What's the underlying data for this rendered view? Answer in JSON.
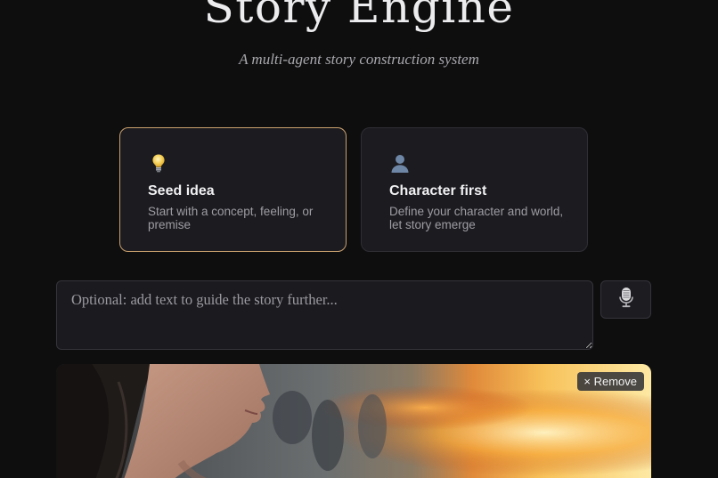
{
  "header": {
    "title": "Story Engine",
    "subtitle": "A multi-agent story construction system"
  },
  "modes": [
    {
      "icon": "lightbulb-icon",
      "title": "Seed idea",
      "description": "Start with a concept, feeling, or premise",
      "selected": true
    },
    {
      "icon": "person-silhouette-icon",
      "title": "Character first",
      "description": "Define your character and world, let story emerge",
      "selected": false
    }
  ],
  "guide_input": {
    "placeholder": "Optional: add text to guide the story further...",
    "value": ""
  },
  "mic_button": {
    "icon": "microphone-icon"
  },
  "image_upload": {
    "remove_label": "× Remove",
    "image_description": "uploaded reference image"
  },
  "colors": {
    "background": "#0e0e0f",
    "card_background": "#1b1b20",
    "selected_border": "#c9a06e",
    "card_border": "#2e2e34"
  }
}
